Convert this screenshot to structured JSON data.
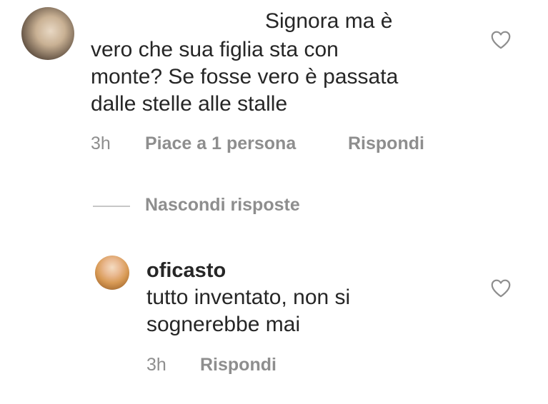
{
  "comment1": {
    "text_line1": "Signora ma è",
    "text_line2": "vero che sua figlia sta con",
    "text_line3": "monte? Se fosse vero è passata",
    "text_line4": "dalle stelle alle stalle",
    "time": "3h",
    "likes": "Piace a 1 persona",
    "reply": "Rispondi"
  },
  "replies_toggle": "Nascondi risposte",
  "comment2": {
    "username": "oficasto",
    "text_line1": "tutto inventato, non si",
    "text_line2": "sognerebbe mai",
    "time": "3h",
    "reply": "Rispondi"
  },
  "icons": {
    "avatar1": "avatar",
    "avatar2": "avatar",
    "like1": "heart-outline-icon",
    "like2": "heart-outline-icon"
  },
  "colors": {
    "text": "#262626",
    "secondary": "#8e8e8e",
    "divider": "#c7c7c7",
    "background": "#ffffff"
  }
}
